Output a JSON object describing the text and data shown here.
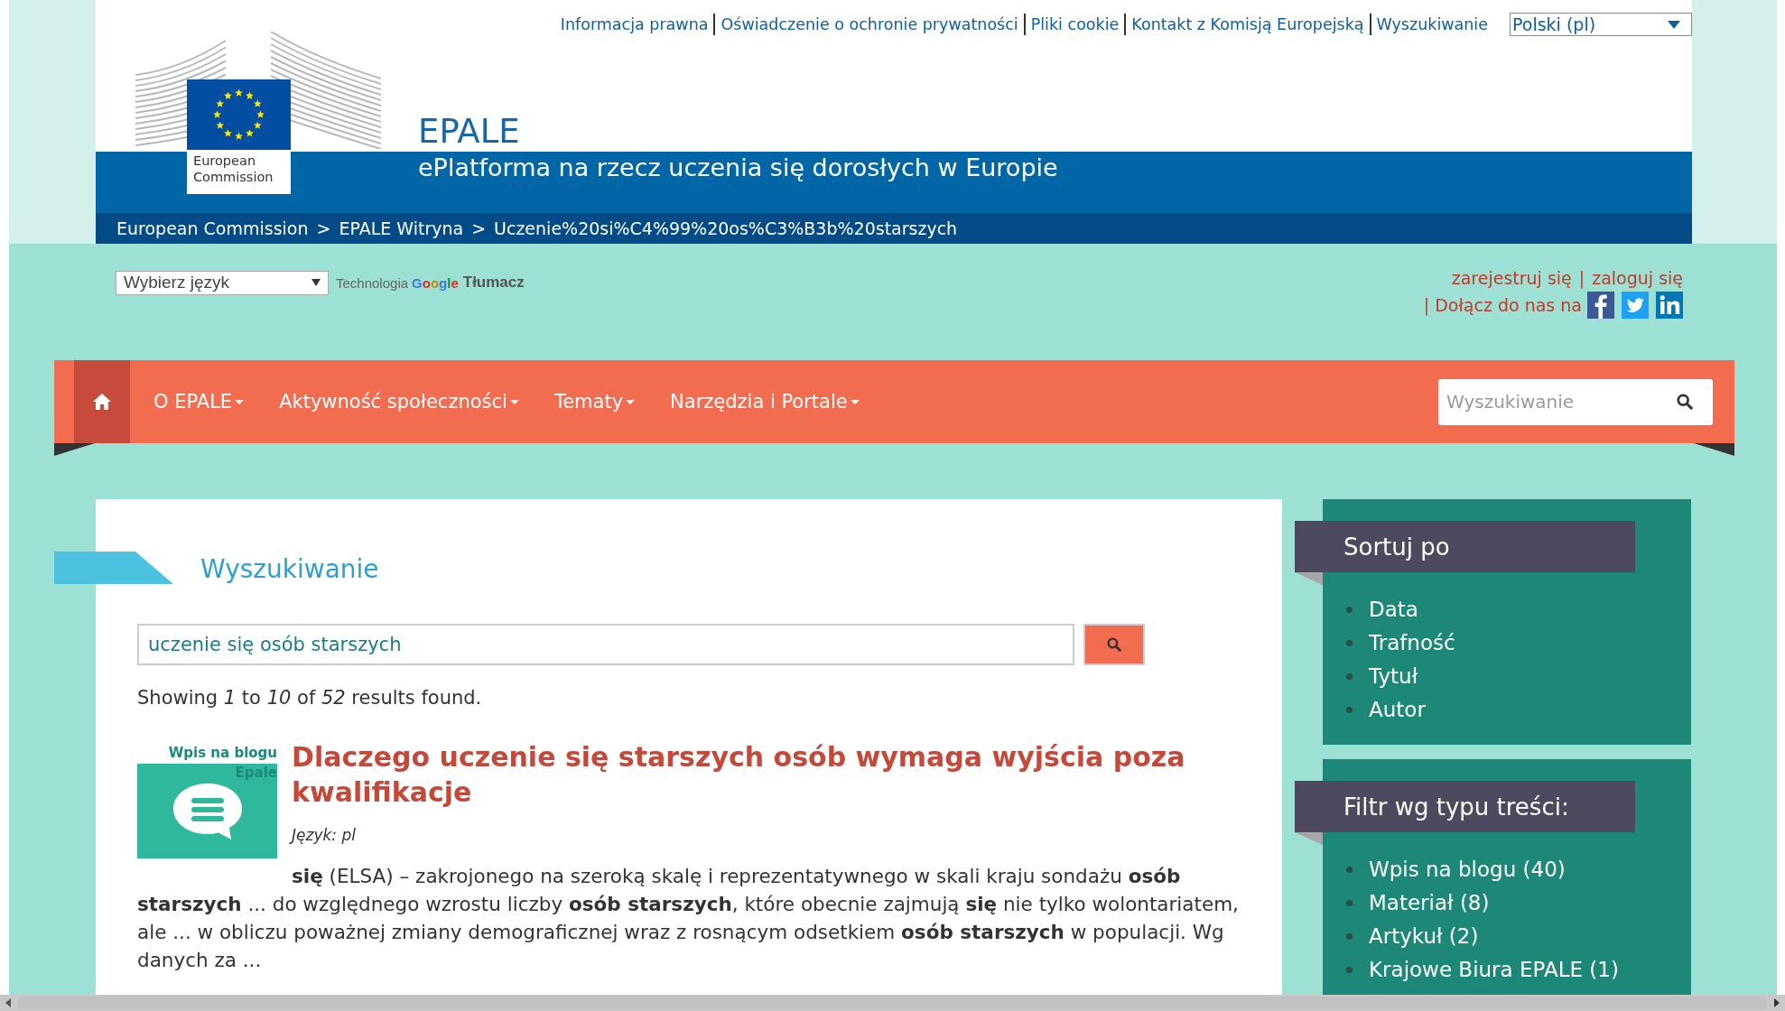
{
  "top_links": [
    {
      "label": "Informacja prawna"
    },
    {
      "label": "Oświadczenie o ochronie prywatności"
    },
    {
      "label": "Pliki cookie"
    },
    {
      "label": "Kontakt z Komisją Europejską"
    },
    {
      "label": "Wyszukiwanie"
    }
  ],
  "language_select": {
    "value": "Polski (pl)"
  },
  "logo": {
    "caption": [
      "European",
      "Commission"
    ]
  },
  "site": {
    "title": "EPALE",
    "subtitle": "ePlatforma na rzecz uczenia się dorosłych w Europie"
  },
  "breadcrumb": {
    "separator": ">",
    "items": [
      "European Commission",
      "EPALE Witryna",
      "Uczenie%20si%C4%99%20os%C3%B3b%20starszych"
    ]
  },
  "translate": {
    "select": "Wybierz język",
    "prefix": "Technologia",
    "brand": "Google",
    "product": "Tłumacz"
  },
  "account": {
    "links": [
      "zarejestruj się",
      "zaloguj się"
    ],
    "separator": "|",
    "join_label": "| Dołącz do nas na",
    "social": [
      {
        "kind": "facebook"
      },
      {
        "kind": "twitter"
      },
      {
        "kind": "linkedin"
      }
    ]
  },
  "nav": {
    "home_selected": true,
    "search_placeholder": "Wyszukiwanie",
    "items": [
      {
        "label": "O EPALE",
        "dropdown": true,
        "selected": false
      },
      {
        "label": "Aktywność społeczności",
        "dropdown": true,
        "selected": false
      },
      {
        "label": "Tematy",
        "dropdown": true,
        "selected": false
      },
      {
        "label": "Narzędzia i Portale",
        "dropdown": true,
        "selected": false
      }
    ]
  },
  "search_page": {
    "heading": "Wyszukiwanie",
    "query": "uczenie się osób starszych",
    "summary": "Showing *1* to *10* of *52* results found.",
    "results": [
      {
        "type_label": [
          "Wpis na blogu",
          "Epale"
        ],
        "title": "Dlaczego uczenie się starszych osób wymaga wyjścia poza kwalifikacje",
        "language": "Język: pl",
        "snippet": "**się** (ELSA) – zakrojonego na szeroką skalę i reprezentatywnego w skali kraju sondażu **osób starszych** ... do względnego wzrostu liczby **osób starszych**, które obecnie zajmują **się** nie tylko wolontariatem, ale ... w obliczu poważnej zmiany demograficznej wraz z rosnącym odsetkiem **osób starszych** w populacji. Wg danych za ..."
      }
    ]
  },
  "sidebar": [
    {
      "title": "Sortuj po",
      "items": [
        "Data",
        "Trafność",
        "Tytuł",
        "Autor"
      ]
    },
    {
      "title": "Filtr wg typu treści:",
      "items": [
        "Wpis na blogu (40)",
        "Materiał (8)",
        "Artykuł (2)",
        "Krajowe Biura EPALE (1)"
      ]
    }
  ]
}
